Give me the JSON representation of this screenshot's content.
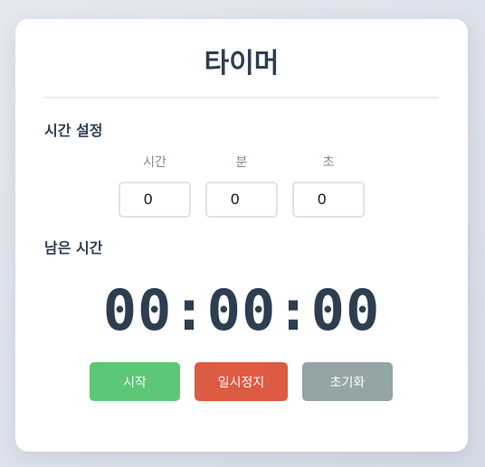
{
  "title": "타이머",
  "time_setting": {
    "label": "시간 설정",
    "hours": {
      "caption": "시간",
      "value": "0"
    },
    "minutes": {
      "caption": "분",
      "value": "0"
    },
    "seconds": {
      "caption": "초",
      "value": "0"
    }
  },
  "remaining": {
    "label": "남은 시간",
    "display": "00:00:00"
  },
  "buttons": {
    "start": "시작",
    "pause": "일시정지",
    "reset": "초기화"
  },
  "colors": {
    "start": "#5cc777",
    "pause": "#dd5a43",
    "reset": "#95a5a6",
    "text": "#2c3e50"
  }
}
